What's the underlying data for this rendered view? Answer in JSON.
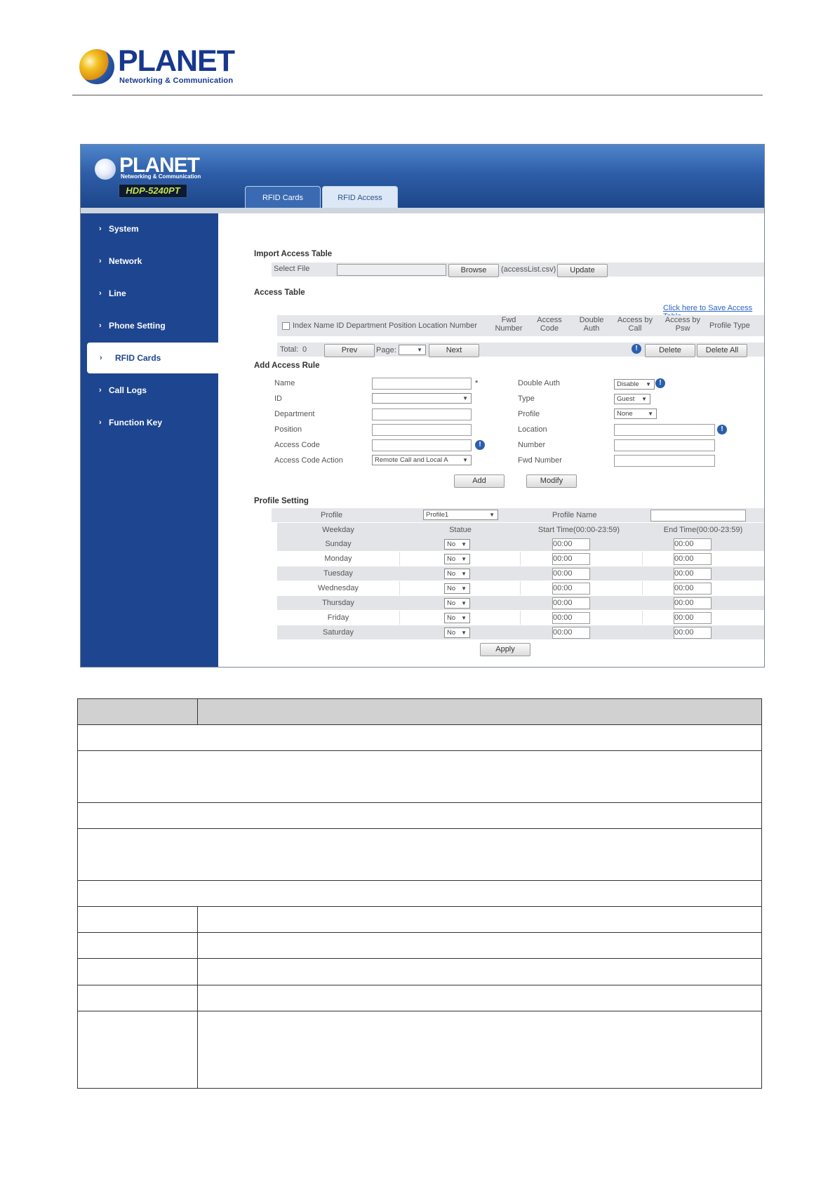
{
  "doc_header": {
    "logo_text": "PLANET",
    "logo_sub": "Networking & Communication"
  },
  "screenshot": {
    "logo_text": "PLANET",
    "logo_sub": "Networking & Communication",
    "model": "HDP-5240PT",
    "tabs": [
      "RFID Cards",
      "RFID Access"
    ],
    "sidebar": [
      "System",
      "Network",
      "Line",
      "Phone Setting",
      "RFID Cards",
      "Call Logs",
      "Function Key"
    ],
    "import": {
      "title": "Import Access Table",
      "select_file_label": "Select File",
      "browse_label": "Browse",
      "file_hint": "(accessList.csv)",
      "update_label": "Update"
    },
    "access_table": {
      "title": "Access Table",
      "save_link": "Click here to Save Access Table",
      "columns_left": "Index Name ID Department Position Location Number",
      "columns": [
        [
          "Fwd",
          "Number"
        ],
        [
          "Access",
          "Code"
        ],
        [
          "Double",
          "Auth"
        ],
        [
          "Access by",
          "Call"
        ],
        [
          "Access by",
          "Psw"
        ],
        [
          "Profile Type",
          ""
        ]
      ],
      "total_label": "Total:",
      "total_value": "0",
      "prev_label": "Prev",
      "page_label": "Page:",
      "next_label": "Next",
      "delete_label": "Delete",
      "delete_all_label": "Delete All"
    },
    "add_rule": {
      "title": "Add Access Rule",
      "left_labels": [
        "Name",
        "ID",
        "Department",
        "Position",
        "Access Code",
        "Access Code Action"
      ],
      "access_code_action_value": "Remote Call and Local A",
      "right_labels": [
        "Double Auth",
        "Type",
        "Profile",
        "Location",
        "Number",
        "Fwd Number"
      ],
      "double_auth_value": "Disable",
      "type_value": "Guest",
      "profile_value": "None",
      "add_label": "Add",
      "modify_label": "Modify",
      "required_mark": "*"
    },
    "profile_setting": {
      "title": "Profile Setting",
      "profile_label": "Profile",
      "profile_value": "Profile1",
      "profile_name_label": "Profile Name",
      "col_weekday": "Weekday",
      "col_statue": "Statue",
      "col_start": "Start Time(00:00-23:59)",
      "col_end": "End Time(00:00-23:59)",
      "days": [
        {
          "day": "Sunday",
          "statue": "No",
          "start": "00:00",
          "end": "00:00"
        },
        {
          "day": "Monday",
          "statue": "No",
          "start": "00:00",
          "end": "00:00"
        },
        {
          "day": "Tuesday",
          "statue": "No",
          "start": "00:00",
          "end": "00:00"
        },
        {
          "day": "Wednesday",
          "statue": "No",
          "start": "00:00",
          "end": "00:00"
        },
        {
          "day": "Thursday",
          "statue": "No",
          "start": "00:00",
          "end": "00:00"
        },
        {
          "day": "Friday",
          "statue": "No",
          "start": "00:00",
          "end": "00:00"
        },
        {
          "day": "Saturday",
          "statue": "No",
          "start": "00:00",
          "end": "00:00"
        }
      ],
      "apply_label": "Apply"
    }
  },
  "colors": {
    "brand_blue": "#1e4690",
    "header_gradient_top": "#4f86cc",
    "table_header_gray": "#d1d1d1",
    "link_blue": "#2a64c4"
  }
}
